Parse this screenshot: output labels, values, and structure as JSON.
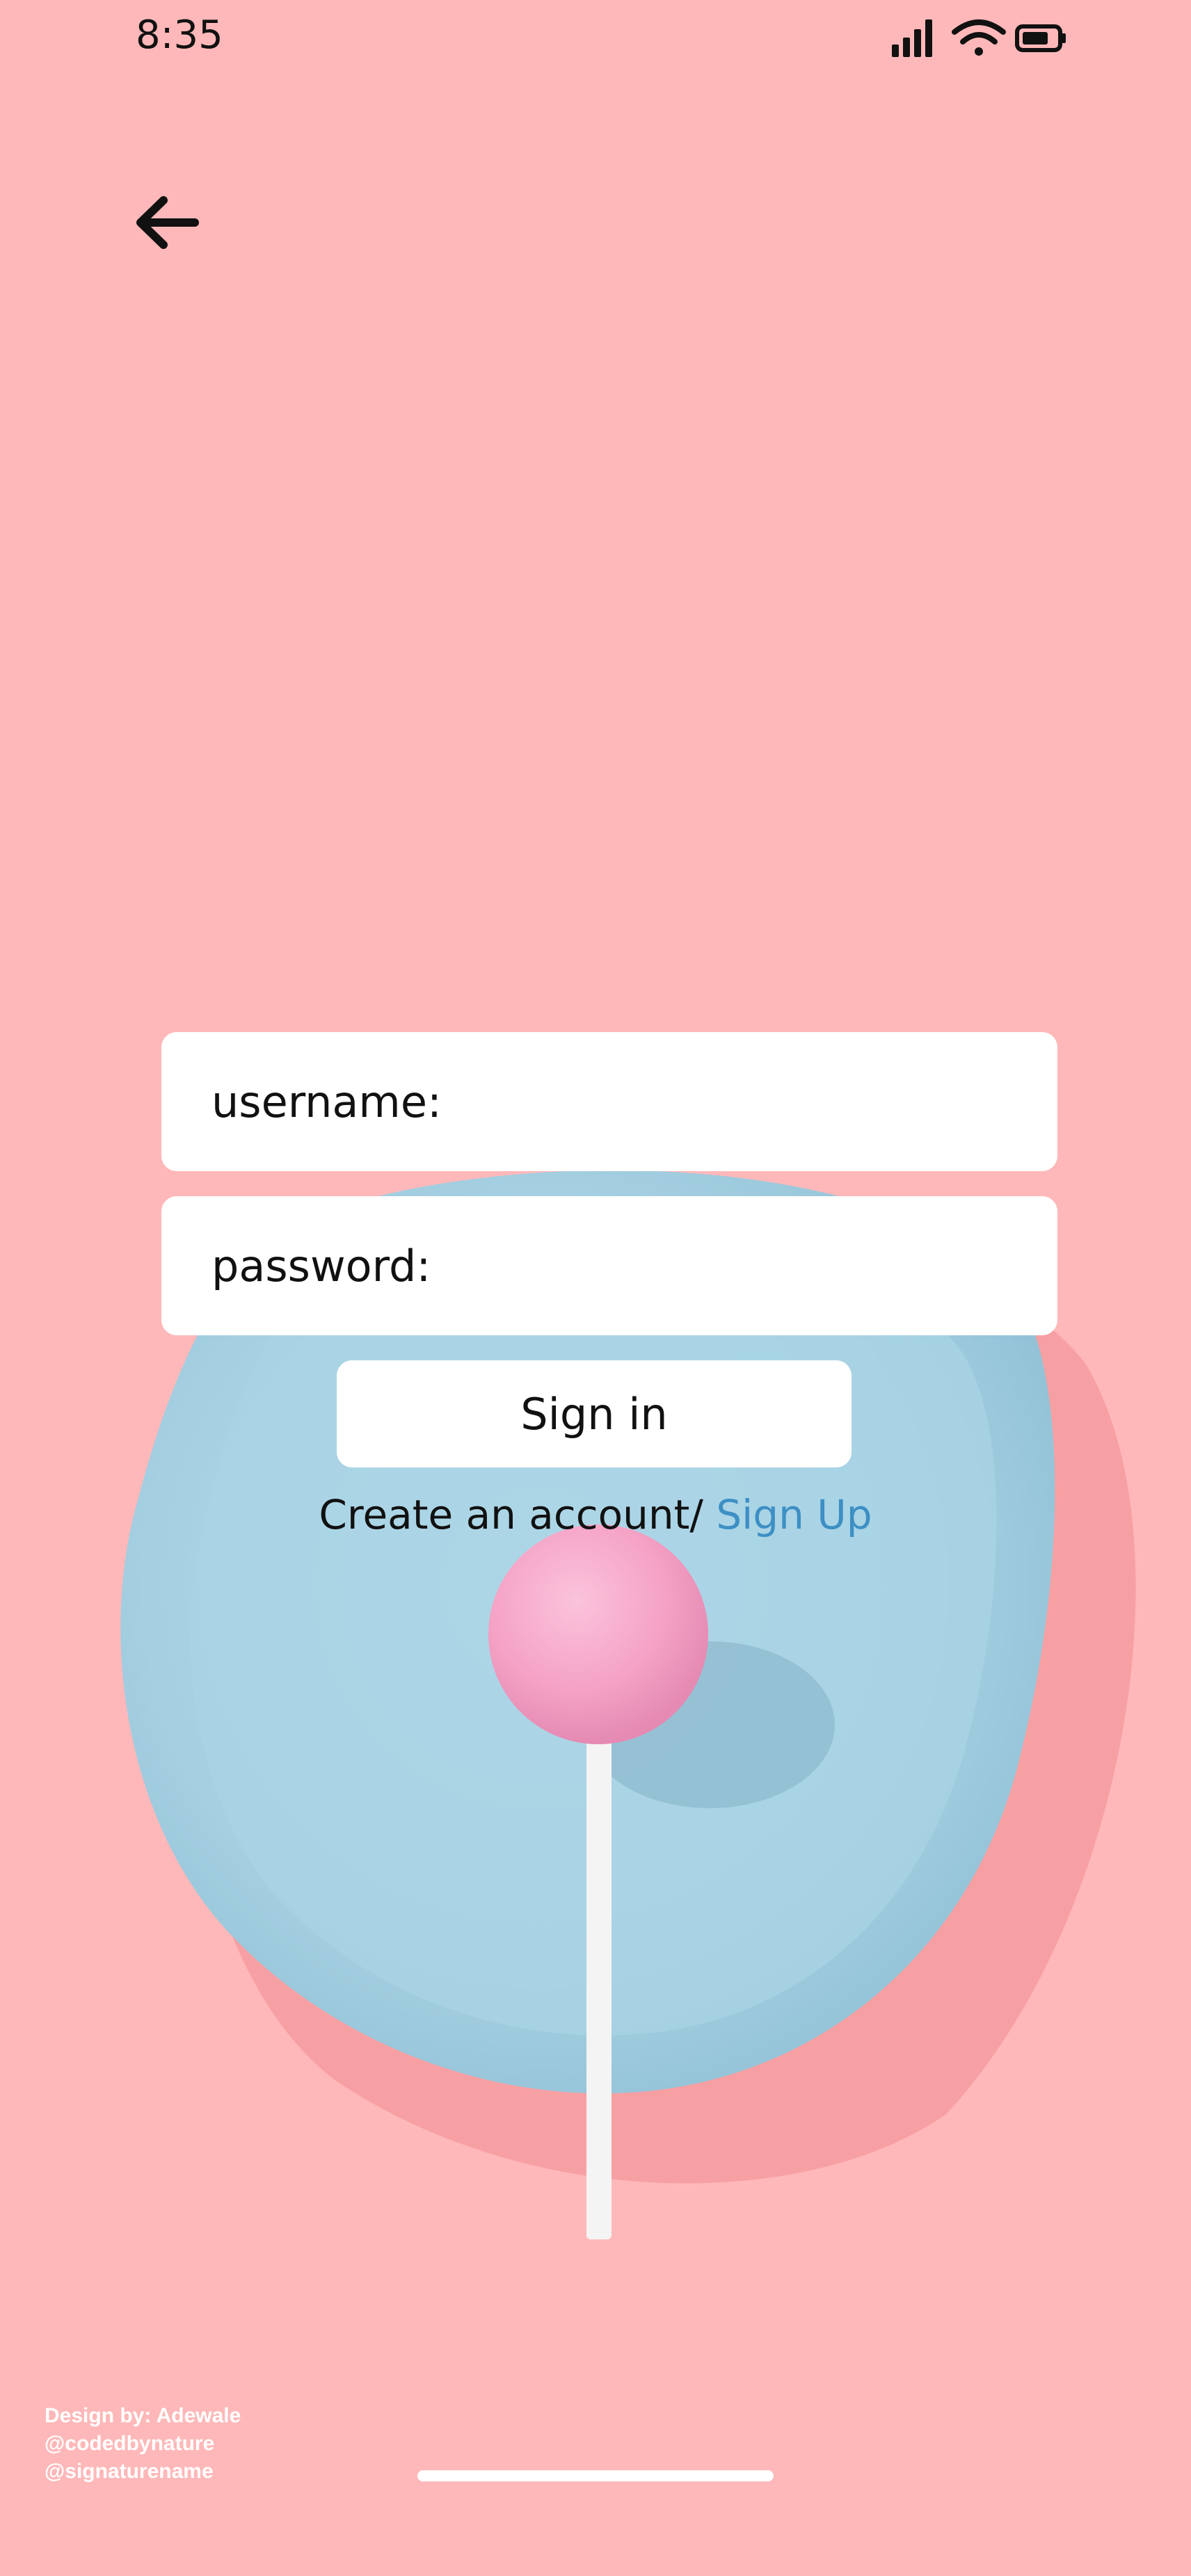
{
  "status_bar": {
    "time": "8:35",
    "icons": [
      "signal-icon",
      "wifi-icon",
      "battery-icon"
    ]
  },
  "nav": {
    "back_icon": "arrow-left-icon"
  },
  "form": {
    "username_placeholder": "username:",
    "password_placeholder": "password:",
    "signin_label": "Sign in",
    "create_account_text": "Create an account/",
    "signup_label": "Sign Up"
  },
  "credits": {
    "line1": "Design by: Adewale",
    "line2": "@codedbynature",
    "line3": "@signaturename"
  },
  "colors": {
    "background": "#ffb8b9",
    "plate": "#a8d3e3",
    "lollipop": "#f7a5c6",
    "link": "#3d8fc4",
    "field": "#ffffff"
  }
}
